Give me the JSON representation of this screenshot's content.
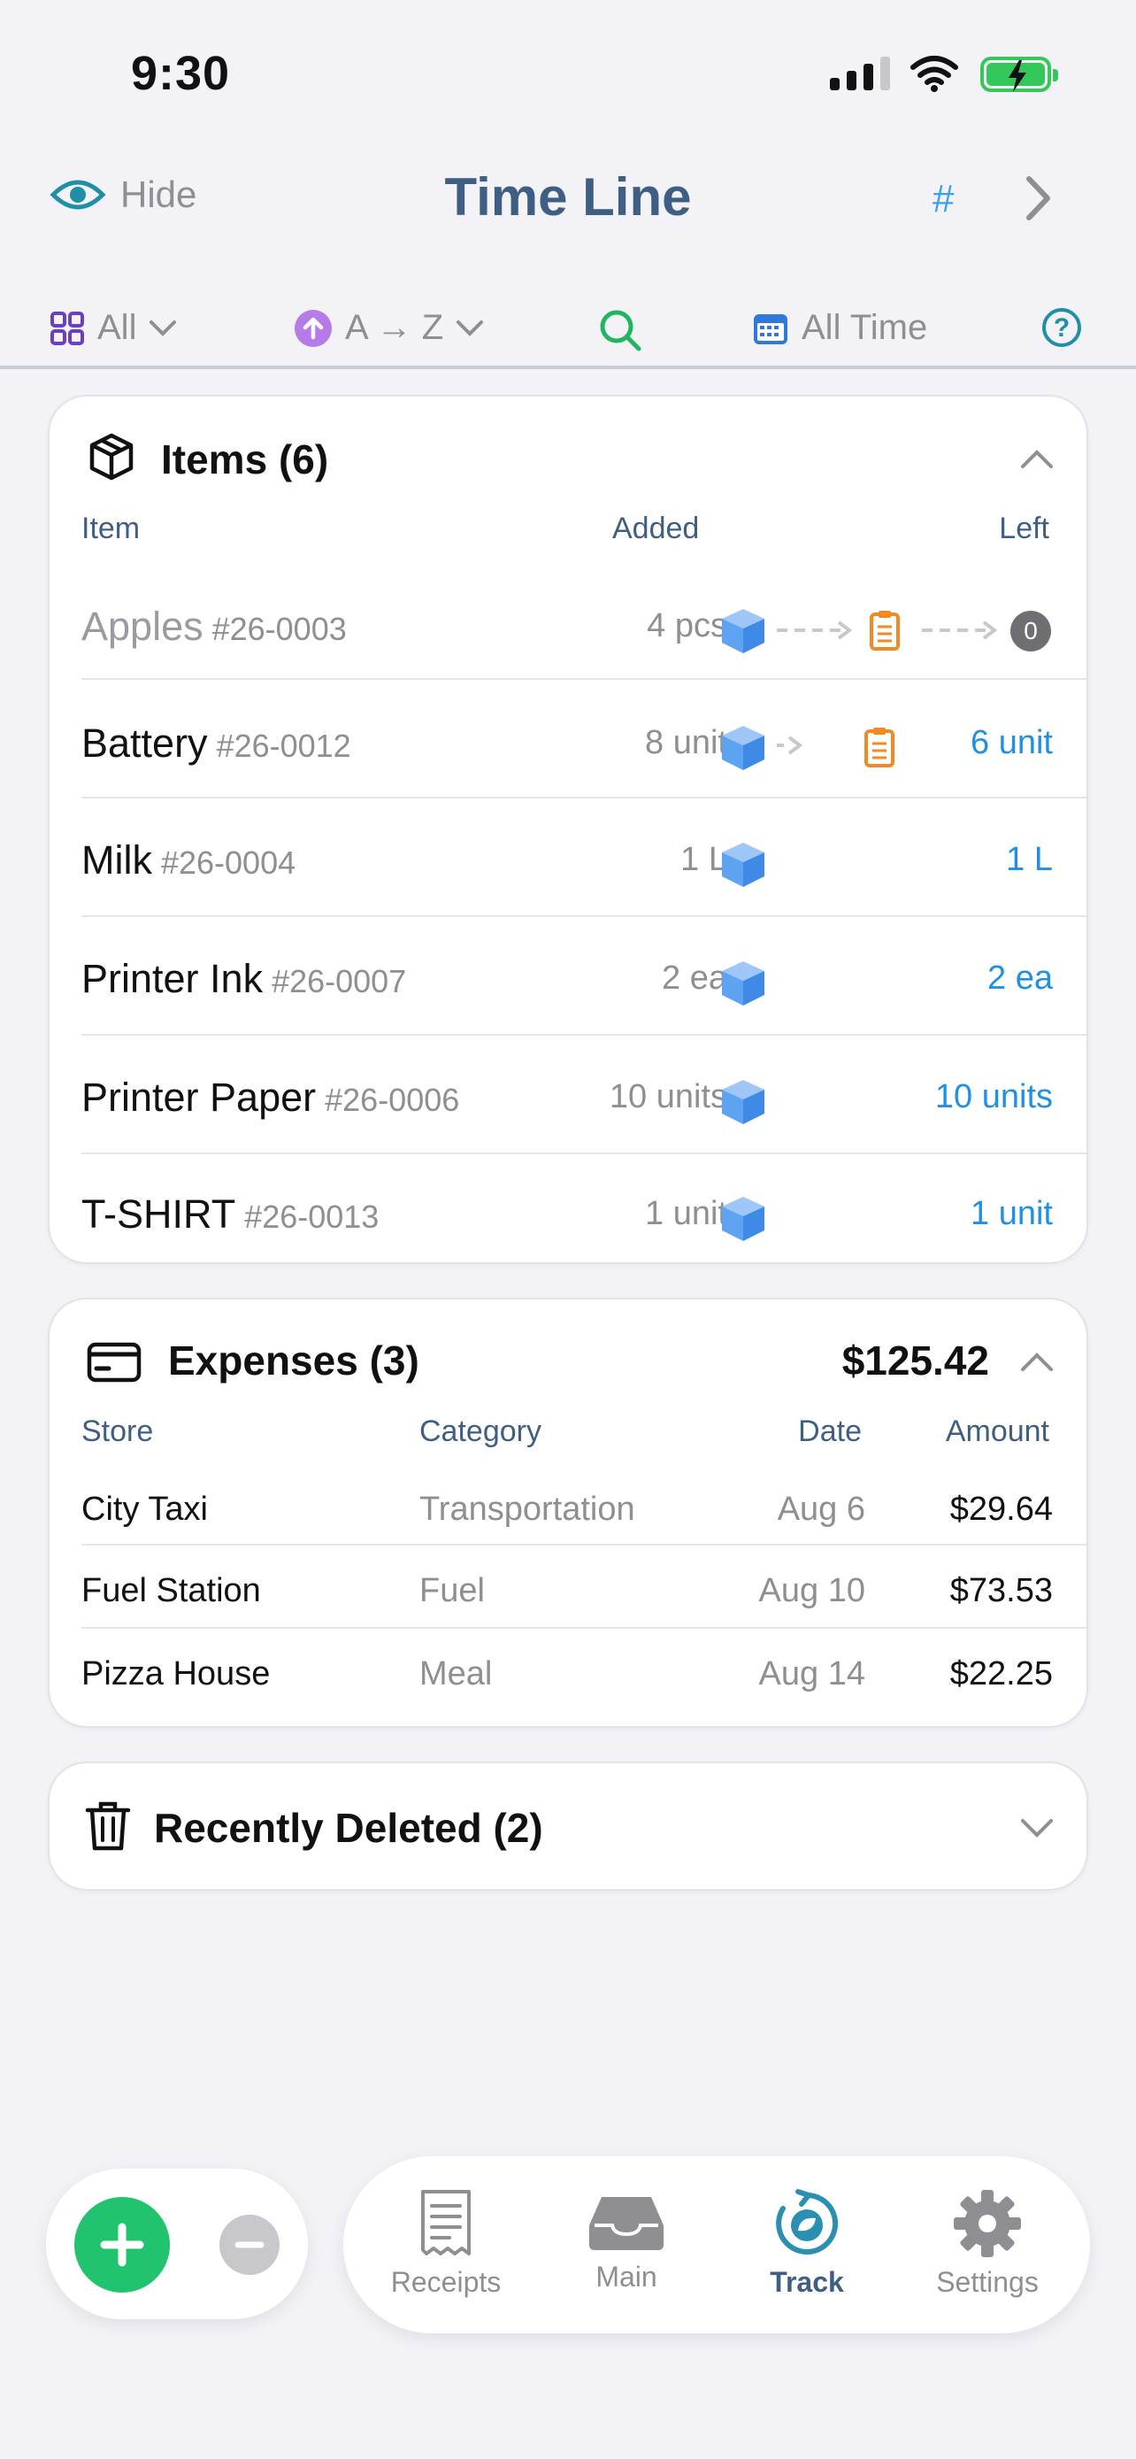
{
  "status_bar": {
    "time": "9:30"
  },
  "nav": {
    "hide_label": "Hide",
    "title": "Time Line",
    "hash_label": "#"
  },
  "filters": {
    "group": "All",
    "sort": "A → Z",
    "range": "All Time",
    "help": "?"
  },
  "items_card": {
    "title": "Items (6)",
    "headers": {
      "item": "Item",
      "added": "Added",
      "left": "Left"
    },
    "rows": [
      {
        "name": "Apples",
        "code": "#26-0003",
        "added": "4 pcs",
        "left": "0",
        "depleted": true
      },
      {
        "name": "Battery",
        "code": "#26-0012",
        "added": "8 unit",
        "left": "6 unit"
      },
      {
        "name": "Milk",
        "code": "#26-0004",
        "added": "1 L",
        "left": "1 L"
      },
      {
        "name": "Printer Ink",
        "code": "#26-0007",
        "added": "2 ea",
        "left": "2 ea"
      },
      {
        "name": "Printer Paper",
        "code": "#26-0006",
        "added": "10 units",
        "left": "10 units"
      },
      {
        "name": "T-SHIRT",
        "code": "#26-0013",
        "added": "1 unit",
        "left": "1 unit"
      }
    ]
  },
  "expenses_card": {
    "title": "Expenses (3)",
    "total": "$125.42",
    "headers": {
      "store": "Store",
      "category": "Category",
      "date": "Date",
      "amount": "Amount"
    },
    "rows": [
      {
        "store": "City Taxi",
        "category": "Transportation",
        "date": "Aug 6",
        "amount": "$29.64"
      },
      {
        "store": "Fuel Station",
        "category": "Fuel",
        "date": "Aug 10",
        "amount": "$73.53"
      },
      {
        "store": "Pizza House",
        "category": "Meal",
        "date": "Aug 14",
        "amount": "$22.25"
      }
    ]
  },
  "deleted_card": {
    "title": "Recently Deleted (2)"
  },
  "tabbar": {
    "receipts": "Receipts",
    "main": "Main",
    "track": "Track",
    "settings": "Settings",
    "active": "Track"
  },
  "colors": {
    "accent_navy": "#3f5e84",
    "accent_blue": "#1f90e6",
    "add_green": "#22c36e",
    "box_blue": "#5ea2f2",
    "receipt_orange": "#f08a24"
  }
}
